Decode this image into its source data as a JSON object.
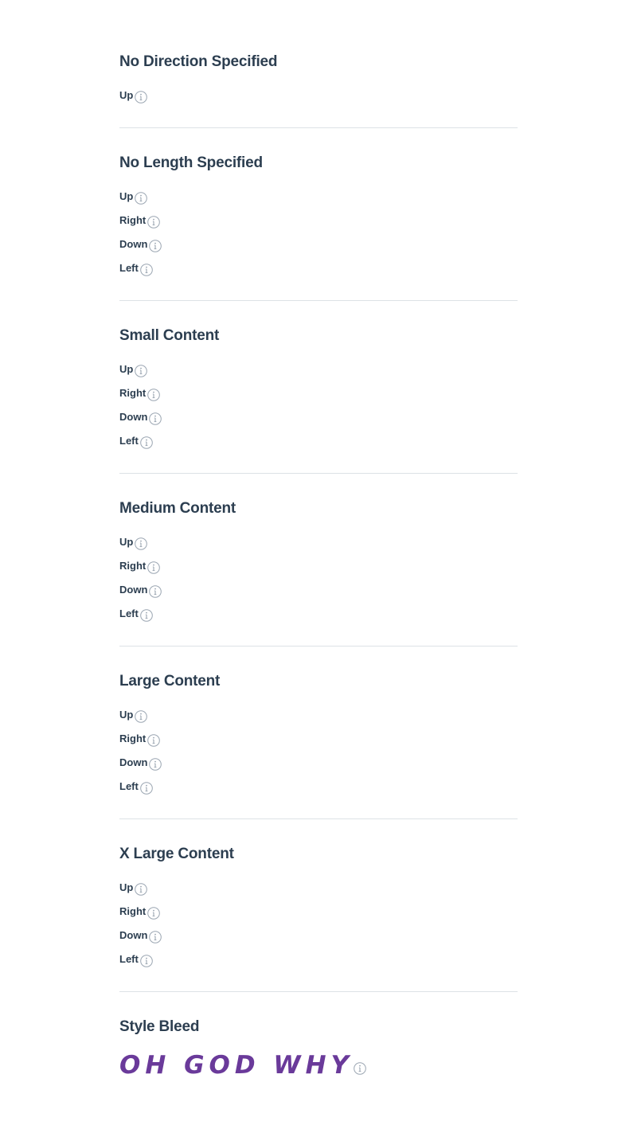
{
  "sections": [
    {
      "title": "No Direction Specified",
      "items": [
        {
          "label": "Up",
          "icon": "info-icon"
        }
      ]
    },
    {
      "title": "No Length Specified",
      "items": [
        {
          "label": "Up",
          "icon": "info-icon"
        },
        {
          "label": "Right",
          "icon": "info-icon"
        },
        {
          "label": "Down",
          "icon": "info-icon"
        },
        {
          "label": "Left",
          "icon": "info-icon"
        }
      ]
    },
    {
      "title": "Small Content",
      "items": [
        {
          "label": "Up",
          "icon": "info-icon"
        },
        {
          "label": "Right",
          "icon": "info-icon"
        },
        {
          "label": "Down",
          "icon": "info-icon"
        },
        {
          "label": "Left",
          "icon": "info-icon"
        }
      ]
    },
    {
      "title": "Medium Content",
      "items": [
        {
          "label": "Up",
          "icon": "info-icon"
        },
        {
          "label": "Right",
          "icon": "info-icon"
        },
        {
          "label": "Down",
          "icon": "info-icon"
        },
        {
          "label": "Left",
          "icon": "info-icon"
        }
      ]
    },
    {
      "title": "Large Content",
      "items": [
        {
          "label": "Up",
          "icon": "info-icon"
        },
        {
          "label": "Right",
          "icon": "info-icon"
        },
        {
          "label": "Down",
          "icon": "info-icon"
        },
        {
          "label": "Left",
          "icon": "info-icon"
        }
      ]
    },
    {
      "title": "X Large Content",
      "items": [
        {
          "label": "Up",
          "icon": "info-icon"
        },
        {
          "label": "Right",
          "icon": "info-icon"
        },
        {
          "label": "Down",
          "icon": "info-icon"
        },
        {
          "label": "Left",
          "icon": "info-icon"
        }
      ]
    },
    {
      "title": "Style Bleed",
      "items": [
        {
          "label": "OH GOD WHY",
          "icon": "info-icon"
        }
      ]
    }
  ],
  "colors": {
    "text": "#2c3e50",
    "divider": "#dde2e6",
    "icon_stroke": "#9aa5b1",
    "bleed_text": "#6a3a9a",
    "background": "#ffffff"
  }
}
